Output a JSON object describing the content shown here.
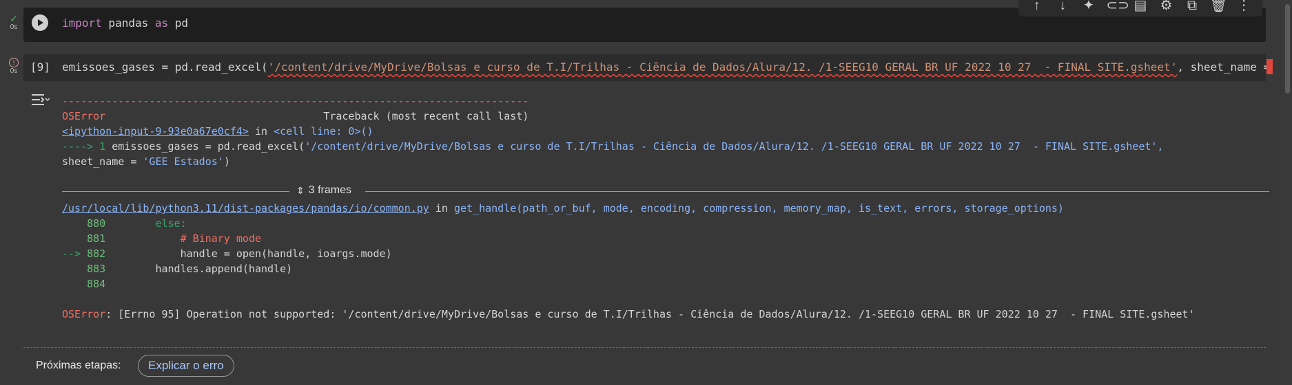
{
  "cell1": {
    "status_time": "0s",
    "code": {
      "kw_import": "import",
      "module": " pandas ",
      "kw_as": "as",
      "alias": " pd"
    }
  },
  "toolbar": {
    "icons": [
      "arrow-up-icon",
      "arrow-down-icon",
      "sparkle-icon",
      "link-icon",
      "comment-icon",
      "gear-icon",
      "mirror-cell-icon",
      "trash-icon",
      "more-vert-icon"
    ]
  },
  "cell2": {
    "status_time": "0s",
    "exec_count": "[9]",
    "code": {
      "lhs": "emissoes_gases = pd.read_excel(",
      "path": "'/content/drive/MyDrive/Bolsas e curso de T.I/Trilhas - Ciência de Dados/Alura/12. /1-SEEG10 GERAL BR UF 2022 10 27  - FINAL SITE.gsheet'",
      "tail": ", sheet_name ="
    }
  },
  "traceback": {
    "dashes": "---------------------------------------------------------------------------",
    "error_name": "OSError",
    "traceback_header": "                                   Traceback (most recent call last)",
    "input_link": "<ipython-input-9-93e0a67e0cf4>",
    "in_text": " in ",
    "cell_line": "<cell line: 0>()",
    "arrow_line": "----> 1 ",
    "arrow_code_a": "emissoes_gases = pd.read_excel(",
    "arrow_code_path": "'/content/drive/MyDrive/Bolsas e curso de T.I/Trilhas - Ciência de Dados/Alura/12. /1-SEEG10 GERAL BR UF 2022 10 27  - FINAL SITE.gsheet',",
    "cont_a": "sheet_name = ",
    "cont_str": "'GEE Estados'",
    "cont_b": ")",
    "frames_label": "3 frames",
    "file_link": "/usr/local/lib/python3.11/dist-packages/pandas/io/common.py",
    "file_in": " in ",
    "file_func": "get_handle(path_or_buf, mode, encoding, compression, memory_map, is_text, errors, storage_options)",
    "lines": [
      {
        "prefix": "    ",
        "no": "880",
        "code": "        else:"
      },
      {
        "prefix": "    ",
        "no": "881",
        "code": "            # Binary mode"
      },
      {
        "prefix": "--> ",
        "no": "882",
        "code": "            handle = open(handle, ioargs.mode)"
      },
      {
        "prefix": "    ",
        "no": "883",
        "code": "        handles.append(handle)"
      },
      {
        "prefix": "    ",
        "no": "884",
        "code": ""
      }
    ],
    "final_error_name": "OSError",
    "final_error_msg": ": [Errno 95] Operation not supported: '/content/drive/MyDrive/Bolsas e curso de T.I/Trilhas - Ciência de Dados/Alura/12. /1-SEEG10 GERAL BR UF 2022 10 27  - FINAL SITE.gsheet'"
  },
  "footer": {
    "next_steps_label": "Próximas etapas:",
    "explain_button": "Explicar o erro"
  }
}
